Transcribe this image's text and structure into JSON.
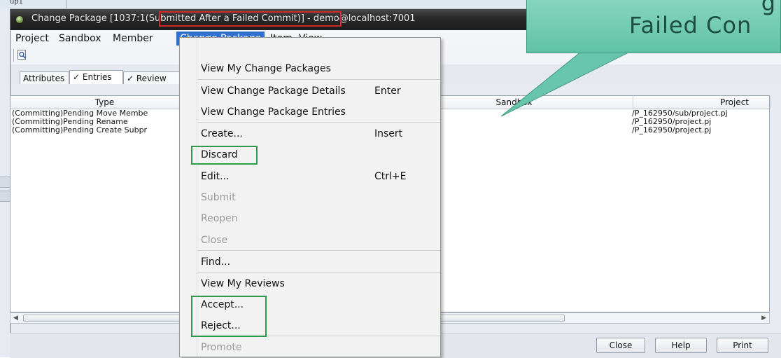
{
  "background_window": {
    "top_label": "up1"
  },
  "window": {
    "title_prefix": "Change Package [1037:1",
    "title_status": "(Submitted After a Failed Commit)]",
    "title_suffix": " - demo@localhost:7001"
  },
  "menubar": {
    "items": [
      "Project",
      "Sandbox",
      "Member",
      "Change Package",
      "Item",
      "View"
    ]
  },
  "tabs": {
    "attributes": "Attributes",
    "entries": "Entries",
    "reviewers": "Review"
  },
  "table": {
    "columns": [
      "Type",
      "Sandbox",
      "Project"
    ],
    "rows": [
      {
        "type": "(Committing)Pending Move Membe",
        "project": "/P_162950/sub/project.pj"
      },
      {
        "type": "(Committing)Pending Rename",
        "project": "/P_162950/project.pj"
      },
      {
        "type": "(Committing)Pending Create Subpr",
        "project": "/P_162950/project.pj"
      }
    ]
  },
  "scrollbar": {
    "left_arrow": "◀",
    "right_arrow": "▶"
  },
  "footer": {
    "close": "Close",
    "help": "Help",
    "print": "Print"
  },
  "dropdown": {
    "view_my_change_packages": "View My Change Packages",
    "view_details": "View Change Package Details",
    "view_details_shortcut": "Enter",
    "view_entries": "View Change Package Entries",
    "create": "Create...",
    "create_shortcut": "Insert",
    "discard": "Discard",
    "edit": "Edit...",
    "edit_shortcut": "Ctrl+E",
    "submit": "Submit",
    "reopen": "Reopen",
    "close": "Close",
    "find": "Find...",
    "view_my_reviews": "View My Reviews",
    "accept": "Accept...",
    "reject": "Reject...",
    "promote": "Promote"
  },
  "callout": {
    "line1": "g",
    "line2": "Failed Con"
  },
  "colors": {
    "menu_highlight": "#2f6fcf",
    "title_box": "#d12a2a",
    "green_box": "#2f9a4a",
    "callout_fill": "#6fcab0"
  }
}
